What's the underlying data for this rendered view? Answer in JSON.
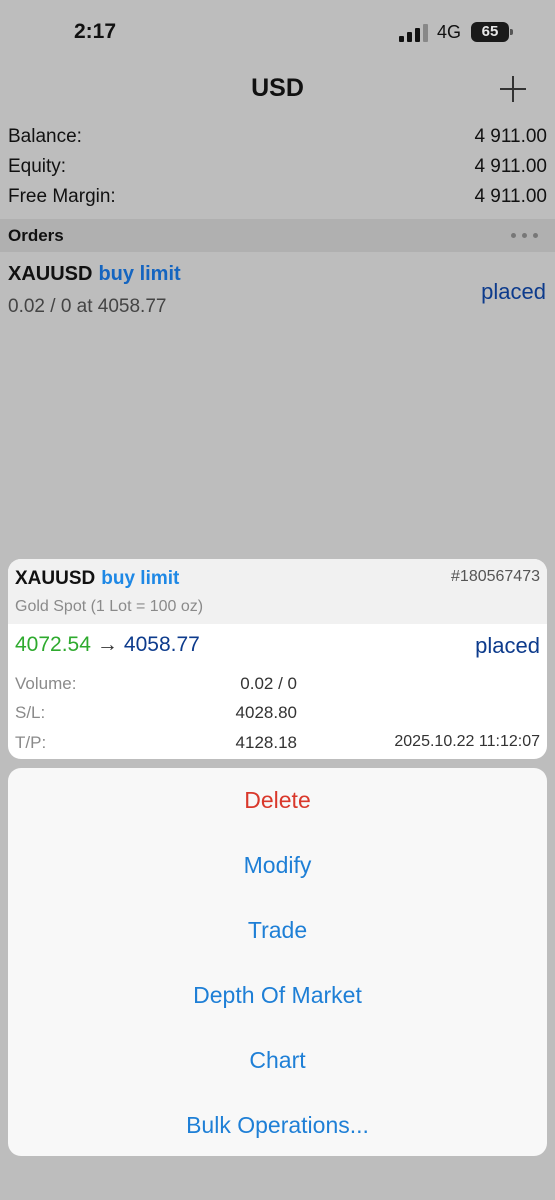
{
  "status_bar": {
    "time": "2:17",
    "network": "4G",
    "battery": "65",
    "battery_level": 0.65
  },
  "header": {
    "title": "USD",
    "add_icon": "plus-icon"
  },
  "account": {
    "balance": {
      "label": "Balance:",
      "value": "4 911.00"
    },
    "equity": {
      "label": "Equity:",
      "value": "4 911.00"
    },
    "free_margin": {
      "label": "Free Margin:",
      "value": "4 911.00"
    }
  },
  "orders_section": {
    "title": "Orders",
    "more_icon": "ellipsis-icon"
  },
  "order": {
    "symbol": "XAUUSD",
    "type": "buy limit",
    "detail": "0.02 / 0 at 4058.77",
    "status": "placed"
  },
  "order_detail": {
    "symbol": "XAUUSD",
    "type": "buy limit",
    "ticket": "#180567473",
    "description": "Gold Spot (1 Lot = 100 oz)",
    "price_from": "4072.54",
    "arrow": "→",
    "price_to": "4058.77",
    "status": "placed",
    "volume_label": "Volume:",
    "volume": "0.02 / 0",
    "sl_label": "S/L:",
    "sl": "4028.80",
    "tp_label": "T/P:",
    "tp": "4128.18",
    "time": "2025.10.22 11:12:07"
  },
  "actions": [
    "Delete",
    "Modify",
    "Trade",
    "Depth Of Market",
    "Chart",
    "Bulk Operations..."
  ],
  "colors": {
    "accent": "#1e7fd6",
    "destructive": "#d9382b",
    "price_up": "#2eaa2e",
    "status": "#0d3b8c"
  }
}
